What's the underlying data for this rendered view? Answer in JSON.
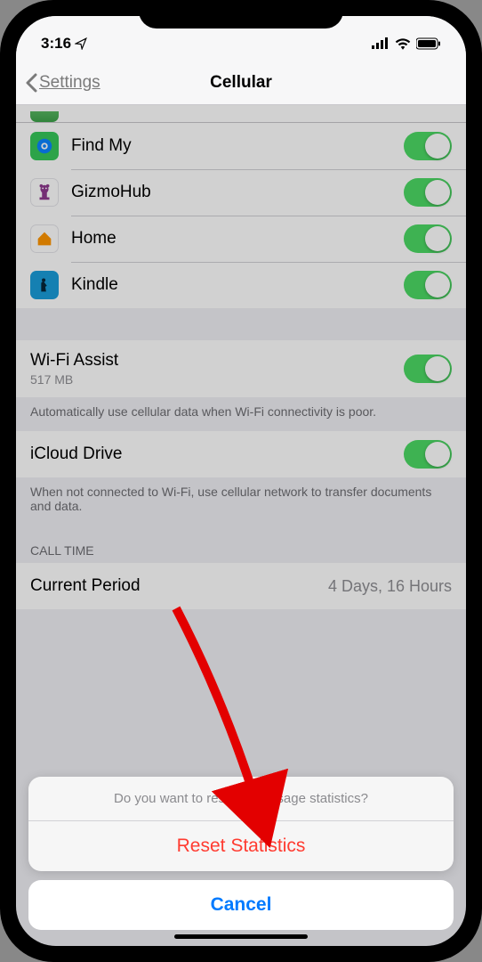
{
  "status": {
    "time": "3:16",
    "location_icon": "location-arrow",
    "signal_icon": "cellular-signal",
    "wifi_icon": "wifi",
    "battery_icon": "battery-full"
  },
  "nav": {
    "back_label": "Settings",
    "title": "Cellular"
  },
  "apps": [
    {
      "name": "Find My",
      "icon_name": "find-my",
      "icon_bg": "#36c759",
      "toggle": "on"
    },
    {
      "name": "GizmoHub",
      "icon_name": "gizmohub",
      "icon_bg": "#ffffff",
      "toggle": "on"
    },
    {
      "name": "Home",
      "icon_name": "home",
      "icon_bg": "#ffffff",
      "toggle": "on"
    },
    {
      "name": "Kindle",
      "icon_name": "kindle",
      "icon_bg": "#1a9dd9",
      "toggle": "on"
    }
  ],
  "wifi_assist": {
    "title": "Wi-Fi Assist",
    "subtitle": "517 MB",
    "footer": "Automatically use cellular data when Wi-Fi connectivity is poor.",
    "toggle": "on"
  },
  "icloud_drive": {
    "title": "iCloud Drive",
    "footer": "When not connected to Wi-Fi, use cellular network to transfer documents and data.",
    "toggle": "on"
  },
  "call_time": {
    "header": "Call Time",
    "row_label": "Current Period",
    "row_value": "4 Days, 16 Hours"
  },
  "action_sheet": {
    "message": "Do you want to reset your usage statistics?",
    "destructive_label": "Reset Statistics",
    "cancel_label": "Cancel"
  }
}
